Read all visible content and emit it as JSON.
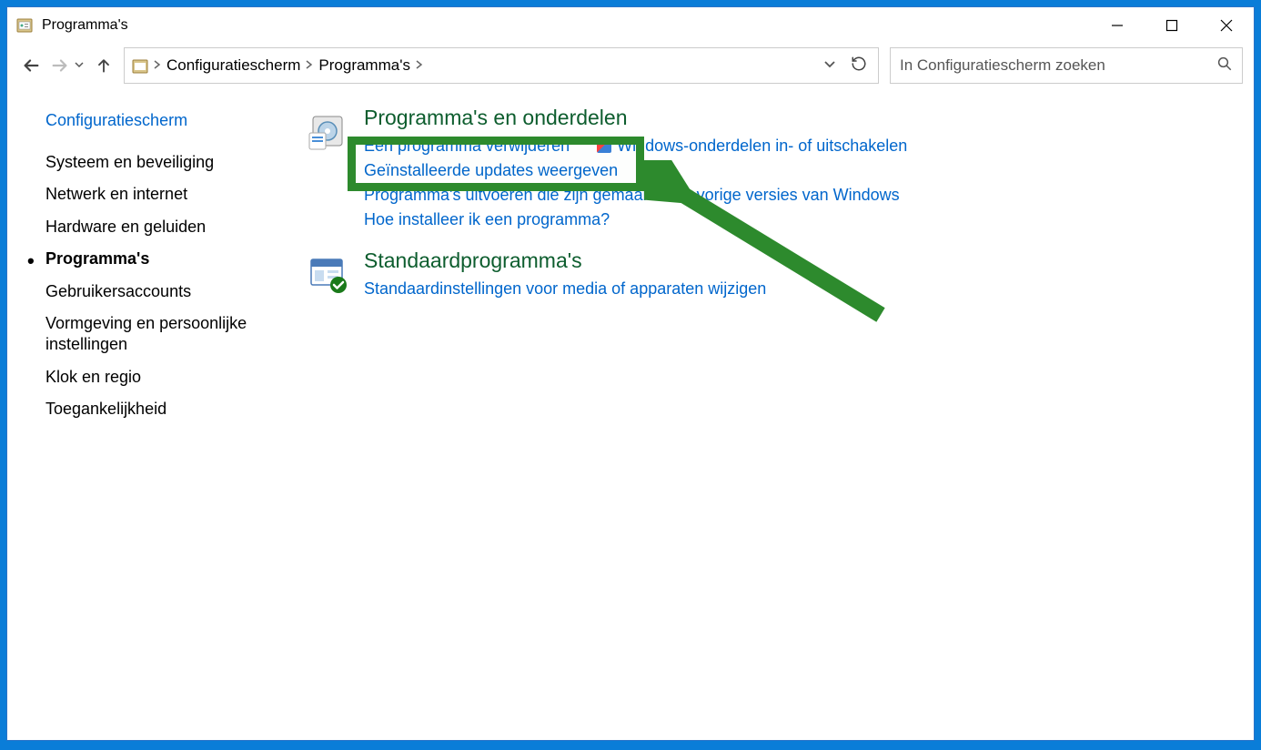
{
  "window": {
    "title": "Programma's"
  },
  "breadcrumb": {
    "items": [
      "Configuratiescherm",
      "Programma's"
    ]
  },
  "search": {
    "placeholder": "In Configuratiescherm zoeken"
  },
  "sidebar": {
    "home": "Configuratiescherm",
    "items": [
      "Systeem en beveiliging",
      "Netwerk en internet",
      "Hardware en geluiden",
      "Programma's",
      "Gebruikersaccounts",
      "Vormgeving en persoonlijke instellingen",
      "Klok en regio",
      "Toegankelijkheid"
    ],
    "current_index": 3
  },
  "main": {
    "categories": [
      {
        "title": "Programma's en onderdelen",
        "links": [
          "Een programma verwijderen",
          "Windows-onderdelen in- of uitschakelen",
          "Geïnstalleerde updates weergeven",
          "Programma's uitvoeren die zijn gemaakt voor vorige versies van Windows",
          "Hoe installeer ik een programma?"
        ],
        "shield_index": 1
      },
      {
        "title": "Standaardprogramma's",
        "links": [
          "Standaardinstellingen voor media of apparaten wijzigen"
        ]
      }
    ]
  },
  "annotation": {
    "highlighted_link": "Geïnstalleerde updates weergeven"
  }
}
